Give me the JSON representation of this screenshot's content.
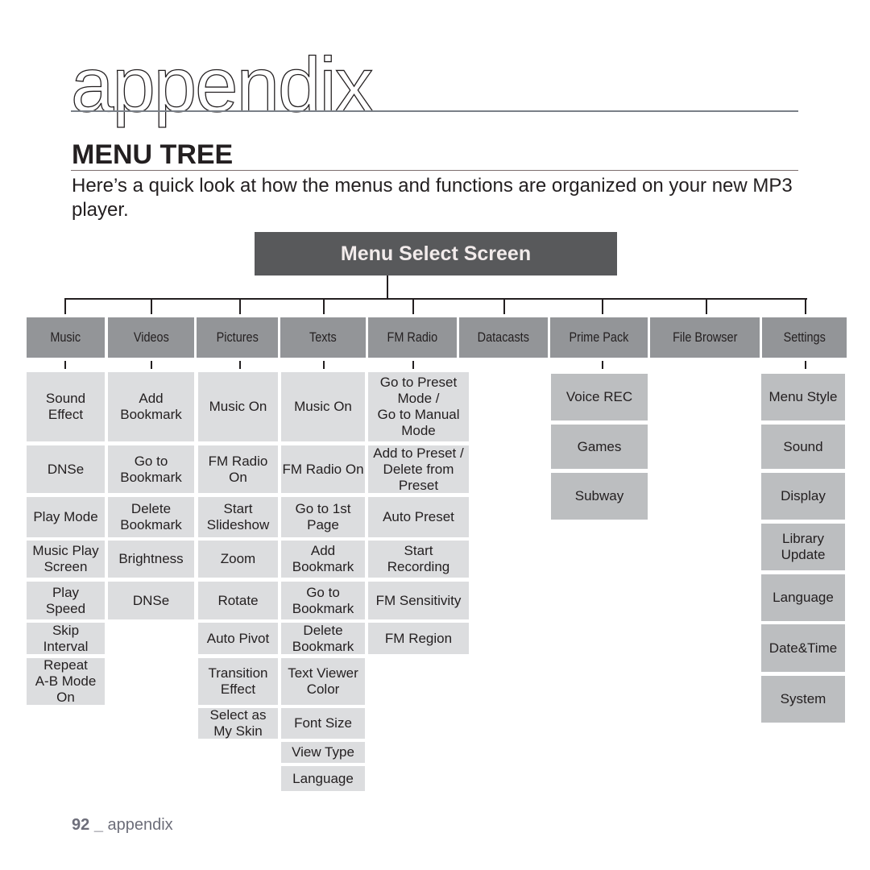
{
  "chapter": {
    "title": "appendix"
  },
  "section": {
    "title": "MENU TREE"
  },
  "intro": "Here’s a quick look at how the menus and functions are organized on your new MP3 player.",
  "root": {
    "label": "Menu Select Screen"
  },
  "categories": [
    {
      "label": "Music",
      "items": [
        "Sound\nEffect",
        "DNSe",
        "Play Mode",
        "Music Play\nScreen",
        "Play\nSpeed",
        "Skip\nInterval",
        "Repeat\nA-B Mode\nOn"
      ]
    },
    {
      "label": "Videos",
      "items": [
        "Add\nBookmark",
        "Go to\nBookmark",
        "Delete\nBookmark",
        "Brightness",
        "DNSe"
      ]
    },
    {
      "label": "Pictures",
      "items": [
        "Music On",
        "FM Radio\nOn",
        "Start\nSlideshow",
        "Zoom",
        "Rotate",
        "Auto Pivot",
        "Transition\nEffect",
        "Select as\nMy Skin"
      ]
    },
    {
      "label": "Texts",
      "items": [
        "Music On",
        "FM Radio On",
        "Go to 1st\nPage",
        "Add\nBookmark",
        "Go to\nBookmark",
        "Delete\nBookmark",
        "Text Viewer\nColor",
        "Font Size",
        "View Type",
        "Language"
      ]
    },
    {
      "label": "FM Radio",
      "items": [
        "Go to Preset\nMode /\nGo to Manual\nMode",
        "Add to Preset /\nDelete from\nPreset",
        "Auto Preset",
        "Start\nRecording",
        "FM Sensitivity",
        "FM Region"
      ]
    },
    {
      "label": "Datacasts",
      "items": []
    },
    {
      "label": "Prime Pack",
      "items": [
        "Voice REC",
        "Games",
        "Subway"
      ]
    },
    {
      "label": "File Browser",
      "items": []
    },
    {
      "label": "Settings",
      "items": [
        "Menu Style",
        "Sound",
        "Display",
        "Library\nUpdate",
        "Language",
        "Date&Time",
        "System"
      ]
    }
  ],
  "footer": {
    "page_number": "92",
    "separator": "_",
    "section": "appendix"
  },
  "colors": {
    "root_box": "#58595b",
    "category_box": "#939598",
    "item_box": "#dcdddf",
    "item_box_dark": "#bcbec0",
    "text": "#231f20"
  }
}
